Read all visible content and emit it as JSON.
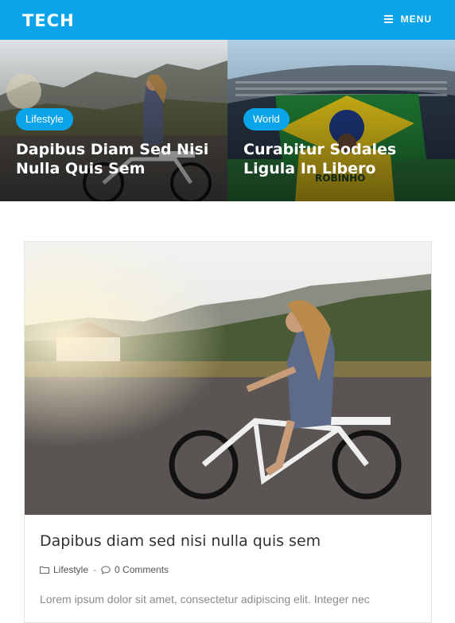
{
  "header": {
    "brand": "TECH",
    "menu_label": "MENU",
    "accent_color": "#0ba3ea"
  },
  "featured": [
    {
      "category": "Lifestyle",
      "title": "Dapibus Diam Sed Nisi Nulla Quis Sem"
    },
    {
      "category": "World",
      "title": "Curabitur Sodales Ligula In Libero"
    }
  ],
  "post": {
    "title": "Dapibus diam sed nisi nulla quis sem",
    "category": "Lifestyle",
    "meta_separator": "-",
    "comments": "0 Comments",
    "excerpt": "Lorem ipsum dolor sit amet, consectetur adipiscing elit. Integer nec"
  },
  "icons": {
    "menu": "hamburger-icon",
    "category": "folder-icon",
    "comments": "comment-icon"
  }
}
